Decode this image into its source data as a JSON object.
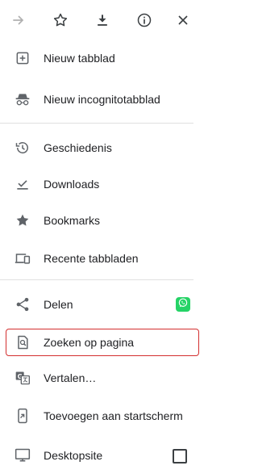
{
  "toolbar": {
    "buttons": [
      {
        "icon": "forward-arrow-icon"
      },
      {
        "icon": "star-icon"
      },
      {
        "icon": "download-icon"
      },
      {
        "icon": "info-icon"
      },
      {
        "icon": "close-icon"
      }
    ]
  },
  "menu": {
    "new_tab": "Nieuw tabblad",
    "new_incognito_tab": "Nieuw incognitotabblad",
    "history": "Geschiedenis",
    "downloads": "Downloads",
    "bookmarks": "Bookmarks",
    "recent_tabs": "Recente tabbladen",
    "share": "Delen",
    "find_in_page": "Zoeken op pagina",
    "translate": "Vertalen…",
    "add_to_home": "Toevoegen aan startscherm",
    "desktop_site": "Desktopsite"
  },
  "colors": {
    "highlight_border": "#d32f2f",
    "whatsapp_green": "#25d366",
    "icon_grey": "#5f6368"
  }
}
